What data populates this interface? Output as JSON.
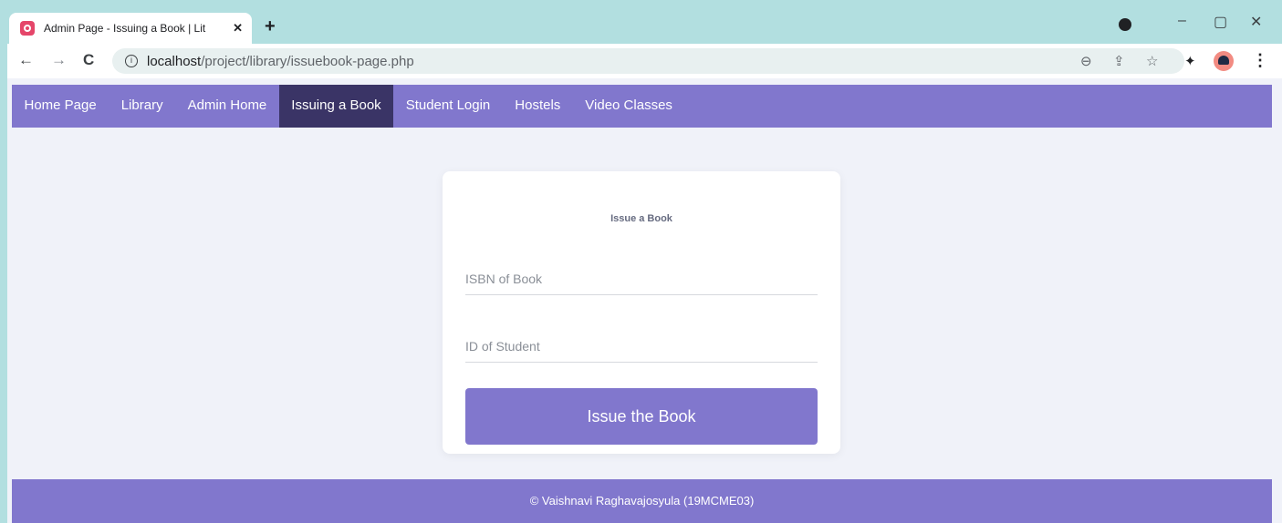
{
  "browser": {
    "tab_title": "Admin Page - Issuing a Book | Lit",
    "tab_close": "✕",
    "new_tab": "+",
    "url_host": "localhost",
    "url_path": "/project/library/issuebook-page.php",
    "back_icon": "←",
    "forward_icon": "→",
    "reload_icon": "C",
    "zoom_icon": "⊖",
    "share_icon": "⇪",
    "star_icon": "☆",
    "extensions_icon": "✦",
    "menu_icon": "⋮",
    "minimize_icon": "–",
    "restore_icon": "▢",
    "close_icon": "✕"
  },
  "nav": {
    "items": [
      {
        "label": "Home Page"
      },
      {
        "label": "Library"
      },
      {
        "label": "Admin Home"
      },
      {
        "label": "Issuing a Book"
      },
      {
        "label": "Student Login"
      },
      {
        "label": "Hostels"
      },
      {
        "label": "Video Classes"
      }
    ],
    "active": "Issuing a Book"
  },
  "form": {
    "title": "Issue a Book",
    "isbn_placeholder": "ISBN of Book",
    "student_placeholder": "ID of Student",
    "submit_label": "Issue the Book"
  },
  "footer": {
    "text": "© Vaishnavi Raghavajosyula (19MCME03)"
  },
  "colors": {
    "accent": "#8177cd",
    "nav_active": "#3a3466",
    "page_bg": "#f0f2f9"
  }
}
